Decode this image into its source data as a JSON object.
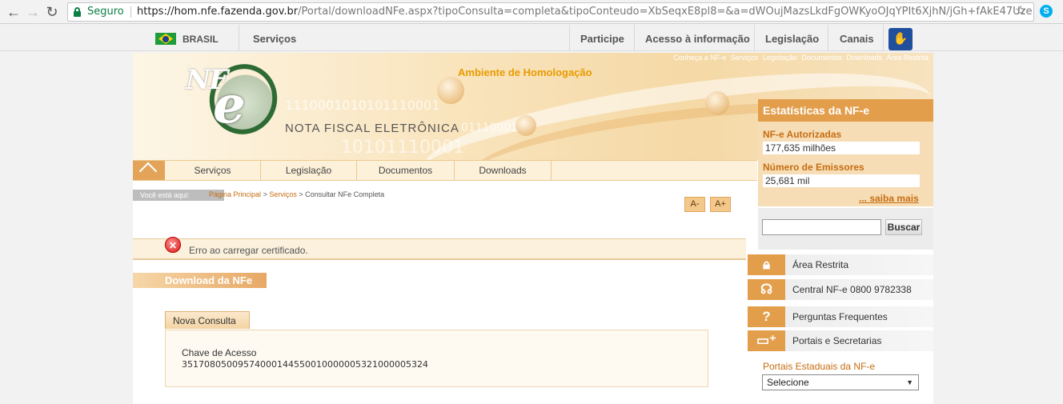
{
  "browser": {
    "secure_label": "Seguro",
    "url_host": "https://hom.nfe.fazenda.gov.br",
    "url_path": "/Portal/downloadNFe.aspx?tipoConsulta=completa&tipoConteudo=XbSeqxE8pl8=&a=dWOujMazsLkdFgOWKyoOJqYPIt6XjhN/jGh+fAkE47Uze..."
  },
  "govbar": {
    "country": "BRASIL",
    "servicos": "Serviços",
    "items": [
      "Participe",
      "Acesso à informação",
      "Legislação",
      "Canais"
    ]
  },
  "banner": {
    "top_links": [
      "Conheça a NF-e",
      "Serviços",
      "Legislação",
      "Documentos",
      "Downloads",
      "Área Restrita"
    ],
    "ambiente": "Ambiente de Homologação",
    "logo_nf": "NF",
    "logo_e": "e",
    "logo_subtitle": "NOTA FISCAL ELETRÔNICA",
    "binary1": "1110001010101110001",
    "binary2": "01110001",
    "binary3": "10101110001"
  },
  "mainnav": {
    "items": [
      "Serviços",
      "Legislação",
      "Documentos",
      "Downloads"
    ]
  },
  "stats": {
    "title": "Estatísticas da NF-e",
    "autorizadas_label": "NF-e Autorizadas",
    "autorizadas_value": "177,635 milhões",
    "emissores_label": "Número de Emissores",
    "emissores_value": "25,681 mil",
    "saiba_mais": "... saiba mais"
  },
  "search": {
    "button": "Buscar"
  },
  "side_menu": {
    "area_restrita": "Área Restrita",
    "central": "Central NF-e 0800 9782338",
    "perguntas": "Perguntas Frequentes",
    "portais": "Portais e Secretarias"
  },
  "portais_estaduais": {
    "label": "Portais Estaduais da NF-e",
    "selected": "Selecione"
  },
  "breadcrumb": {
    "tag": "Você está aqui:",
    "home": "Página Principal",
    "servicos": "Serviços",
    "current": "Consultar NFe Completa"
  },
  "font_controls": {
    "decrease": "A-",
    "increase": "A+"
  },
  "error": {
    "message": "Erro ao carregar certificado."
  },
  "content": {
    "section_title": "Download da NFe",
    "tab": "Nova Consulta",
    "chave_label": "Chave de Acesso",
    "chave_value": "35170805009574000144550010000005321000005324"
  }
}
